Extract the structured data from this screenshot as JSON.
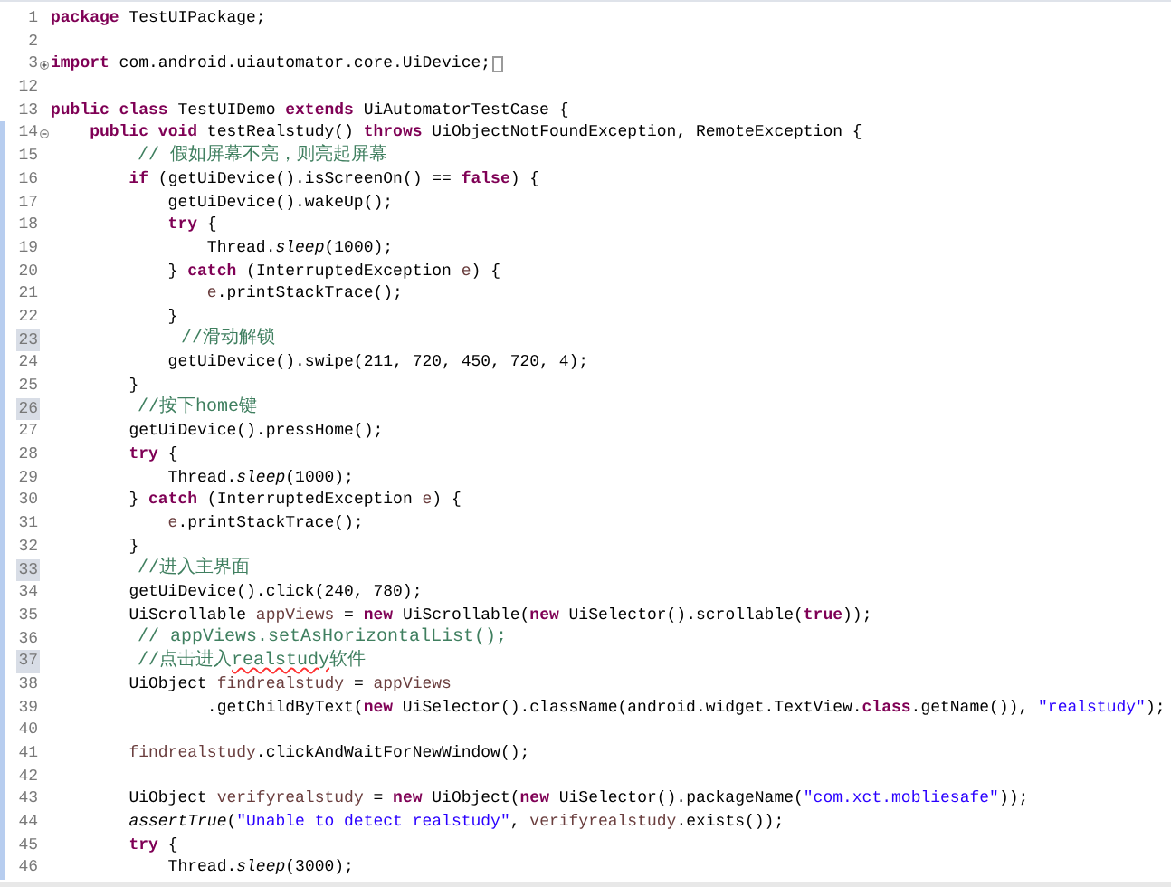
{
  "editor": {
    "lines": [
      {
        "number": "1",
        "changed": false,
        "marked": false,
        "tokens": [
          {
            "kind": "keyword",
            "text": "package"
          },
          {
            "kind": "plain",
            "text": " TestUIPackage;"
          }
        ]
      },
      {
        "number": "2",
        "changed": false,
        "marked": false
      },
      {
        "number": "3",
        "changed": false,
        "marked": false,
        "collapsed": true,
        "tokens": [
          {
            "kind": "keyword",
            "text": "import"
          },
          {
            "kind": "plain",
            "text": " com.android.uiautomator.core.UiDevice;"
          }
        ]
      },
      {
        "number": "12",
        "changed": false,
        "marked": false
      },
      {
        "number": "13",
        "changed": false,
        "marked": false,
        "tokens": [
          {
            "kind": "keyword",
            "text": "public"
          },
          {
            "kind": "keyword",
            "text": " class"
          },
          {
            "kind": "plain",
            "text": " TestUIDemo "
          },
          {
            "kind": "keyword",
            "text": "extends"
          },
          {
            "kind": "plain",
            "text": " UiAutomatorTestCase {"
          }
        ]
      },
      {
        "number": "14",
        "changed": true,
        "marked": false,
        "collapsed": false,
        "tokens": [
          {
            "kind": "keyword",
            "text": "    public"
          },
          {
            "kind": "keyword",
            "text": " void"
          },
          {
            "kind": "plain",
            "text": " testRealstudy() "
          },
          {
            "kind": "keyword",
            "text": "throws"
          },
          {
            "kind": "plain",
            "text": " UiObjectNotFoundException, RemoteException {"
          }
        ]
      },
      {
        "number": "15",
        "changed": true,
        "marked": false,
        "tokens": [
          {
            "kind": "comment",
            "text": "        // 假如屏幕不亮，则亮起屏幕"
          }
        ]
      },
      {
        "number": "16",
        "changed": true,
        "marked": false,
        "tokens": [
          {
            "kind": "keyword",
            "text": "        if"
          },
          {
            "kind": "plain",
            "text": " (getUiDevice().isScreenOn() == "
          },
          {
            "kind": "keyword",
            "text": "false"
          },
          {
            "kind": "plain",
            "text": ") {"
          }
        ]
      },
      {
        "number": "17",
        "changed": true,
        "marked": false,
        "tokens": [
          {
            "kind": "plain",
            "text": "            getUiDevice().wakeUp();"
          }
        ]
      },
      {
        "number": "18",
        "changed": true,
        "marked": false,
        "tokens": [
          {
            "kind": "keyword",
            "text": "            try"
          },
          {
            "kind": "plain",
            "text": " {"
          }
        ]
      },
      {
        "number": "19",
        "changed": true,
        "marked": false,
        "tokens": [
          {
            "kind": "plain",
            "text": "                Thread."
          },
          {
            "kind": "static",
            "text": "sleep"
          },
          {
            "kind": "plain",
            "text": "(1000);"
          }
        ]
      },
      {
        "number": "20",
        "changed": true,
        "marked": false,
        "tokens": [
          {
            "kind": "plain",
            "text": "            } "
          },
          {
            "kind": "keyword",
            "text": "catch"
          },
          {
            "kind": "plain",
            "text": " (InterruptedException "
          },
          {
            "kind": "local",
            "text": "e"
          },
          {
            "kind": "plain",
            "text": ") {"
          }
        ]
      },
      {
        "number": "21",
        "changed": true,
        "marked": false,
        "tokens": [
          {
            "kind": "local",
            "text": "                e"
          },
          {
            "kind": "plain",
            "text": ".printStackTrace();"
          }
        ]
      },
      {
        "number": "22",
        "changed": true,
        "marked": false,
        "tokens": [
          {
            "kind": "plain",
            "text": "            }"
          }
        ]
      },
      {
        "number": "23",
        "changed": true,
        "marked": true,
        "tokens": [
          {
            "kind": "comment",
            "text": "            //滑动解锁"
          }
        ]
      },
      {
        "number": "24",
        "changed": true,
        "marked": false,
        "tokens": [
          {
            "kind": "plain",
            "text": "            getUiDevice().swipe(211, 720, 450, 720, 4);"
          }
        ]
      },
      {
        "number": "25",
        "changed": true,
        "marked": false,
        "tokens": [
          {
            "kind": "plain",
            "text": "        }"
          }
        ]
      },
      {
        "number": "26",
        "changed": true,
        "marked": true,
        "tokens": [
          {
            "kind": "comment",
            "text": "        //按下home键"
          }
        ]
      },
      {
        "number": "27",
        "changed": true,
        "marked": false,
        "tokens": [
          {
            "kind": "plain",
            "text": "        getUiDevice().pressHome();"
          }
        ]
      },
      {
        "number": "28",
        "changed": true,
        "marked": false,
        "tokens": [
          {
            "kind": "keyword",
            "text": "        try"
          },
          {
            "kind": "plain",
            "text": " {"
          }
        ]
      },
      {
        "number": "29",
        "changed": true,
        "marked": false,
        "tokens": [
          {
            "kind": "plain",
            "text": "            Thread."
          },
          {
            "kind": "static",
            "text": "sleep"
          },
          {
            "kind": "plain",
            "text": "(1000);"
          }
        ]
      },
      {
        "number": "30",
        "changed": true,
        "marked": false,
        "tokens": [
          {
            "kind": "plain",
            "text": "        } "
          },
          {
            "kind": "keyword",
            "text": "catch"
          },
          {
            "kind": "plain",
            "text": " (InterruptedException "
          },
          {
            "kind": "local",
            "text": "e"
          },
          {
            "kind": "plain",
            "text": ") {"
          }
        ]
      },
      {
        "number": "31",
        "changed": true,
        "marked": false,
        "tokens": [
          {
            "kind": "local",
            "text": "            e"
          },
          {
            "kind": "plain",
            "text": ".printStackTrace();"
          }
        ]
      },
      {
        "number": "32",
        "changed": true,
        "marked": false,
        "tokens": [
          {
            "kind": "plain",
            "text": "        }"
          }
        ]
      },
      {
        "number": "33",
        "changed": true,
        "marked": true,
        "tokens": [
          {
            "kind": "comment",
            "text": "        //进入主界面"
          }
        ]
      },
      {
        "number": "34",
        "changed": true,
        "marked": false,
        "tokens": [
          {
            "kind": "plain",
            "text": "        getUiDevice().click(240, 780);"
          }
        ]
      },
      {
        "number": "35",
        "changed": true,
        "marked": false,
        "tokens": [
          {
            "kind": "plain",
            "text": "        UiScrollable "
          },
          {
            "kind": "local",
            "text": "appViews"
          },
          {
            "kind": "plain",
            "text": " = "
          },
          {
            "kind": "keyword",
            "text": "new"
          },
          {
            "kind": "plain",
            "text": " UiScrollable("
          },
          {
            "kind": "keyword",
            "text": "new"
          },
          {
            "kind": "plain",
            "text": " UiSelector().scrollable("
          },
          {
            "kind": "keyword",
            "text": "true"
          },
          {
            "kind": "plain",
            "text": "));"
          }
        ]
      },
      {
        "number": "36",
        "changed": true,
        "marked": false,
        "tokens": [
          {
            "kind": "comment",
            "text": "        // appViews.setAsHorizontalList();"
          }
        ]
      },
      {
        "number": "37",
        "changed": true,
        "marked": true,
        "tokens": [
          {
            "kind": "comment",
            "text": "        //点击进入",
            "misspelled": false
          },
          {
            "kind": "comment",
            "text": "realstudy",
            "misspelled": true
          },
          {
            "kind": "comment",
            "text": "软件",
            "misspelled": false
          }
        ]
      },
      {
        "number": "38",
        "changed": true,
        "marked": false,
        "tokens": [
          {
            "kind": "plain",
            "text": "        UiObject "
          },
          {
            "kind": "local",
            "text": "findrealstudy"
          },
          {
            "kind": "plain",
            "text": " = "
          },
          {
            "kind": "local",
            "text": "appViews"
          }
        ]
      },
      {
        "number": "39",
        "changed": true,
        "marked": false,
        "tokens": [
          {
            "kind": "plain",
            "text": "                .getChildByText("
          },
          {
            "kind": "keyword",
            "text": "new"
          },
          {
            "kind": "plain",
            "text": " UiSelector().className(android.widget.TextView."
          },
          {
            "kind": "keyword",
            "text": "class"
          },
          {
            "kind": "plain",
            "text": ".getName()), "
          },
          {
            "kind": "string",
            "text": "\"realstudy\""
          },
          {
            "kind": "plain",
            "text": ");"
          }
        ]
      },
      {
        "number": "40",
        "changed": true,
        "marked": false
      },
      {
        "number": "41",
        "changed": true,
        "marked": false,
        "tokens": [
          {
            "kind": "local",
            "text": "        findrealstudy"
          },
          {
            "kind": "plain",
            "text": ".clickAndWaitForNewWindow();"
          }
        ]
      },
      {
        "number": "42",
        "changed": true,
        "marked": false
      },
      {
        "number": "43",
        "changed": true,
        "marked": false,
        "tokens": [
          {
            "kind": "plain",
            "text": "        UiObject "
          },
          {
            "kind": "local",
            "text": "verifyrealstudy"
          },
          {
            "kind": "plain",
            "text": " = "
          },
          {
            "kind": "keyword",
            "text": "new"
          },
          {
            "kind": "plain",
            "text": " UiObject("
          },
          {
            "kind": "keyword",
            "text": "new"
          },
          {
            "kind": "plain",
            "text": " UiSelector().packageName("
          },
          {
            "kind": "string",
            "text": "\"com.xct.mobliesafe\""
          },
          {
            "kind": "plain",
            "text": "));"
          }
        ]
      },
      {
        "number": "44",
        "changed": true,
        "marked": false,
        "tokens": [
          {
            "kind": "static",
            "text": "        assertTrue"
          },
          {
            "kind": "plain",
            "text": "("
          },
          {
            "kind": "string",
            "text": "\"Unable to detect realstudy\""
          },
          {
            "kind": "plain",
            "text": ", "
          },
          {
            "kind": "local",
            "text": "verifyrealstudy"
          },
          {
            "kind": "plain",
            "text": ".exists());"
          }
        ]
      },
      {
        "number": "45",
        "changed": true,
        "marked": false,
        "tokens": [
          {
            "kind": "keyword",
            "text": "        try"
          },
          {
            "kind": "plain",
            "text": " {"
          }
        ]
      },
      {
        "number": "46",
        "changed": true,
        "marked": false,
        "tokens": [
          {
            "kind": "plain",
            "text": "            Thread."
          },
          {
            "kind": "static",
            "text": "sleep"
          },
          {
            "kind": "plain",
            "text": "(3000);"
          }
        ]
      }
    ]
  }
}
